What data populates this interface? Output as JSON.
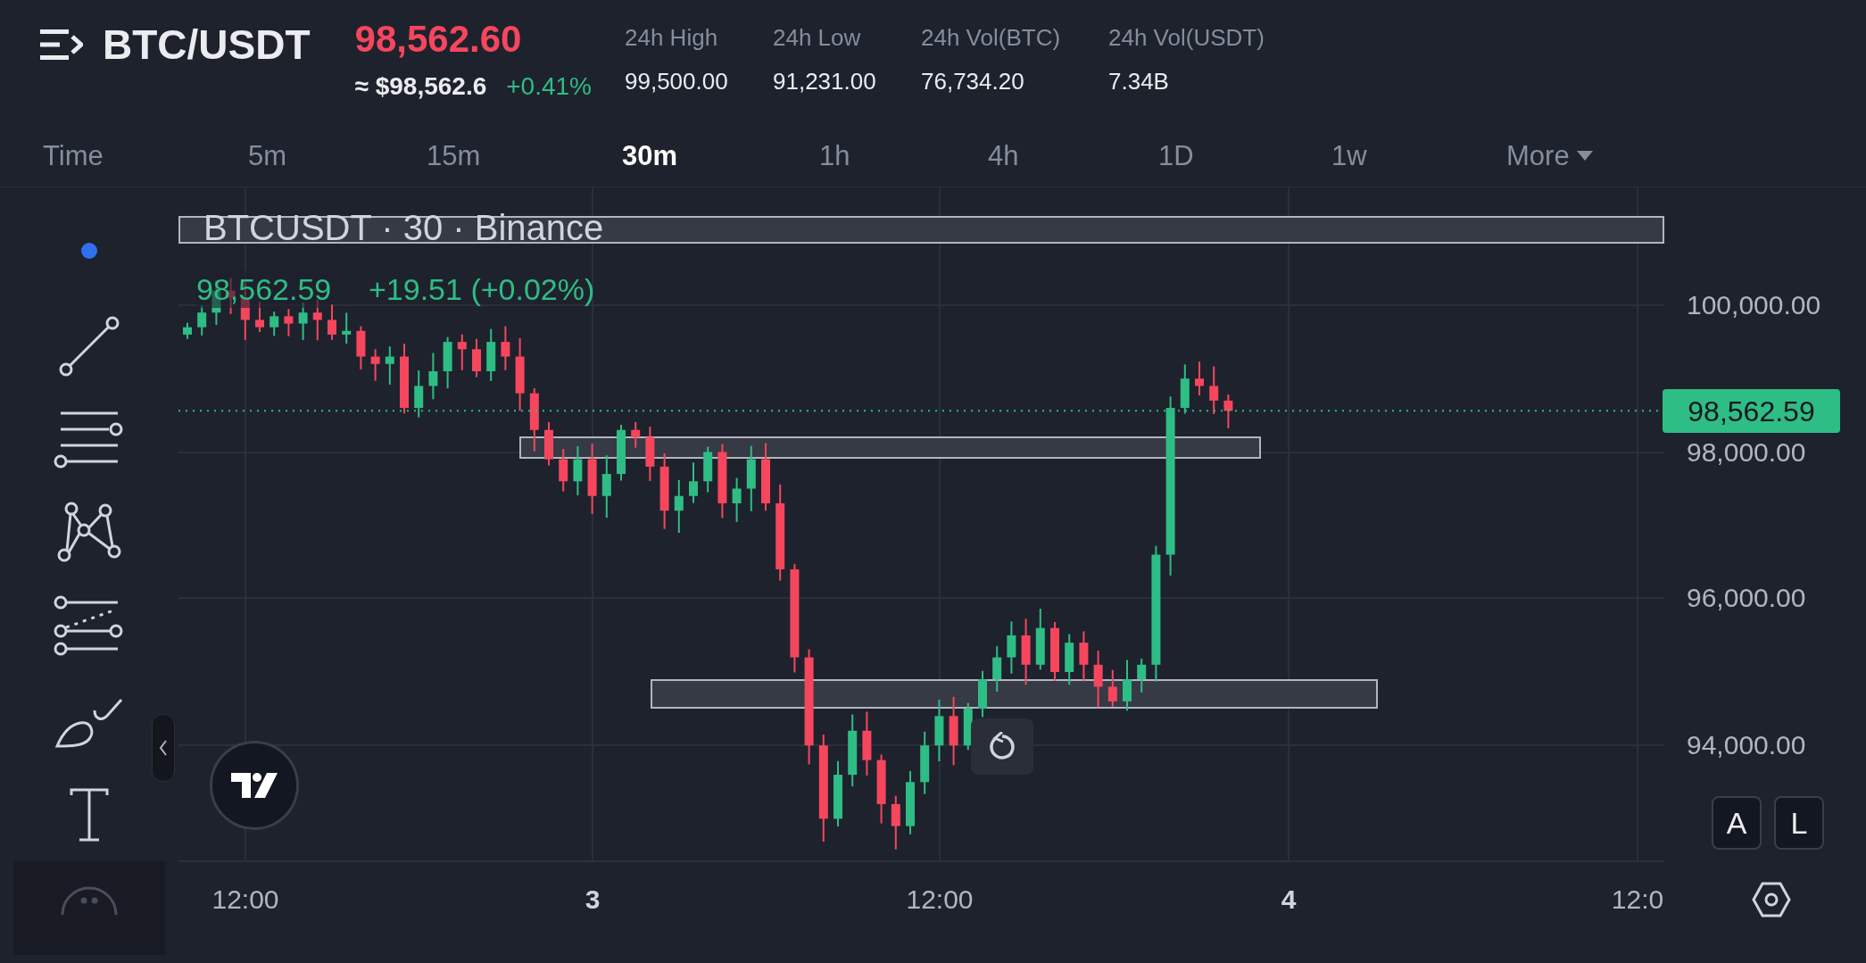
{
  "header": {
    "pair": "BTC/USDT",
    "last_price": "98,562.60",
    "usd_price": "≈ $98,562.6",
    "change": "+0.41%",
    "stats": [
      {
        "label": "24h High",
        "value": "99,500.00"
      },
      {
        "label": "24h Low",
        "value": "91,231.00"
      },
      {
        "label": "24h Vol(BTC)",
        "value": "76,734.20"
      },
      {
        "label": "24h Vol(USDT)",
        "value": "7.34B"
      }
    ]
  },
  "timeframes": [
    {
      "label": "Time",
      "selected": false
    },
    {
      "label": "5m",
      "selected": false
    },
    {
      "label": "15m",
      "selected": false
    },
    {
      "label": "30m",
      "selected": true
    },
    {
      "label": "1h",
      "selected": false
    },
    {
      "label": "4h",
      "selected": false
    },
    {
      "label": "1D",
      "selected": false
    },
    {
      "label": "1w",
      "selected": false
    },
    {
      "label": "More",
      "selected": false
    }
  ],
  "chart": {
    "legend": {
      "title": "BTCUSDT · 30 · Binance",
      "price": "98,562.59",
      "change": "+19.51 (+0.02%)"
    },
    "price_axis": [
      "100,000.00",
      "98,000.00",
      "96,000.00",
      "94,000.00"
    ],
    "current_price": "98,562.59",
    "time_axis": [
      {
        "label": "12:00",
        "bold": false
      },
      {
        "label": "3",
        "bold": true
      },
      {
        "label": "12:00",
        "bold": false
      },
      {
        "label": "4",
        "bold": true
      },
      {
        "label": "12:0",
        "bold": false
      }
    ],
    "scale_buttons": [
      "A",
      "L"
    ]
  }
}
